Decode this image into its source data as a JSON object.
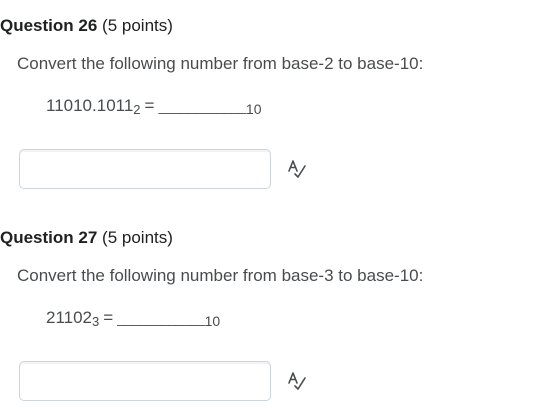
{
  "questions": [
    {
      "title": "Question 26",
      "points": "(5 points)",
      "prompt": "Convert the following number from base-2 to base-10:",
      "number": "11010.1011",
      "number_base": "2",
      "equals": "=",
      "blank": "____________",
      "target_base": "10",
      "answer_value": "",
      "spellcheck_icon": "spell-check-icon"
    },
    {
      "title": "Question 27",
      "points": "(5 points)",
      "prompt": "Convert the following number from base-3 to base-10:",
      "number": "21102",
      "number_base": "3",
      "equals": "=",
      "blank": "____________",
      "target_base": "10",
      "answer_value": "",
      "spellcheck_icon": "spell-check-icon"
    }
  ]
}
